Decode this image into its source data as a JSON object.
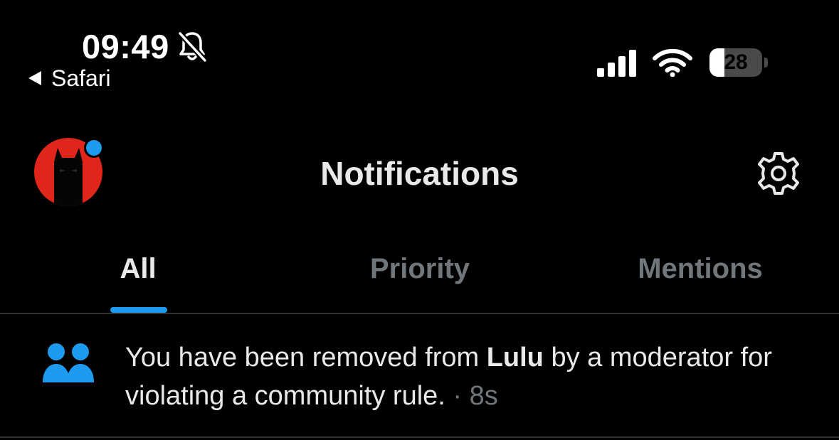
{
  "status_bar": {
    "time": "09:49",
    "back_app": "Safari",
    "battery_level": "28",
    "battery_fraction": 0.28,
    "icons": [
      "bell-slash-icon",
      "cellular-signal-icon",
      "wifi-icon",
      "battery-icon"
    ]
  },
  "header": {
    "title": "Notifications",
    "avatar_icon": "profile-avatar",
    "settings_icon": "gear-icon"
  },
  "tabs": [
    {
      "label": "All",
      "active": true
    },
    {
      "label": "Priority",
      "active": false
    },
    {
      "label": "Mentions",
      "active": false
    }
  ],
  "notifications": [
    {
      "icon": "community-people-icon",
      "text_before": "You have been removed from ",
      "community": "Lulu",
      "text_after": " by a moderator for violating a community rule.",
      "separator": " · ",
      "time": "8s"
    }
  ],
  "colors": {
    "background": "#000000",
    "text_primary": "#e7e9ea",
    "text_secondary": "#71767b",
    "accent": "#1d9bf0",
    "divider": "#2f3336",
    "avatar_red": "#e0251b"
  }
}
